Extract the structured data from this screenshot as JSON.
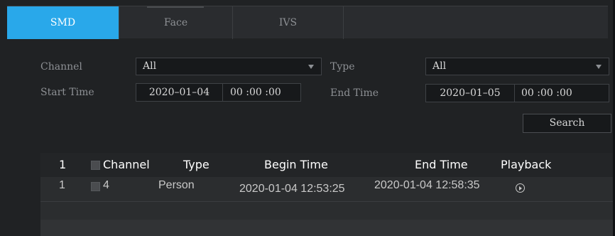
{
  "tabs": [
    {
      "label": "SMD",
      "active": true
    },
    {
      "label": "Face",
      "active": false
    },
    {
      "label": "IVS",
      "active": false
    }
  ],
  "filters": {
    "channel_label": "Channel",
    "channel_value": "All",
    "type_label": "Type",
    "type_value": "All",
    "start_label": "Start Time",
    "start_date": "2020–01–04",
    "start_time": "00 :00 :00",
    "end_label": "End Time",
    "end_date": "2020–01–05",
    "end_time": "00 :00 :00",
    "search_button": "Search"
  },
  "table": {
    "headers": {
      "index": "1",
      "channel": "Channel",
      "type": "Type",
      "begin": "Begin Time",
      "end": "End Time",
      "playback": "Playback"
    },
    "rows": [
      {
        "index": "1",
        "channel": "4",
        "type": "Person",
        "begin": "2020-01-04 12:53:25",
        "end": "2020-01-04 12:58:35"
      }
    ]
  },
  "icons": {
    "playback": "play-circle-icon",
    "dropdown": "chevron-down-icon",
    "checkbox": "checkbox-icon"
  },
  "colors": {
    "accent": "#29a8ea",
    "background": "#202224",
    "text": "#8d9094"
  }
}
